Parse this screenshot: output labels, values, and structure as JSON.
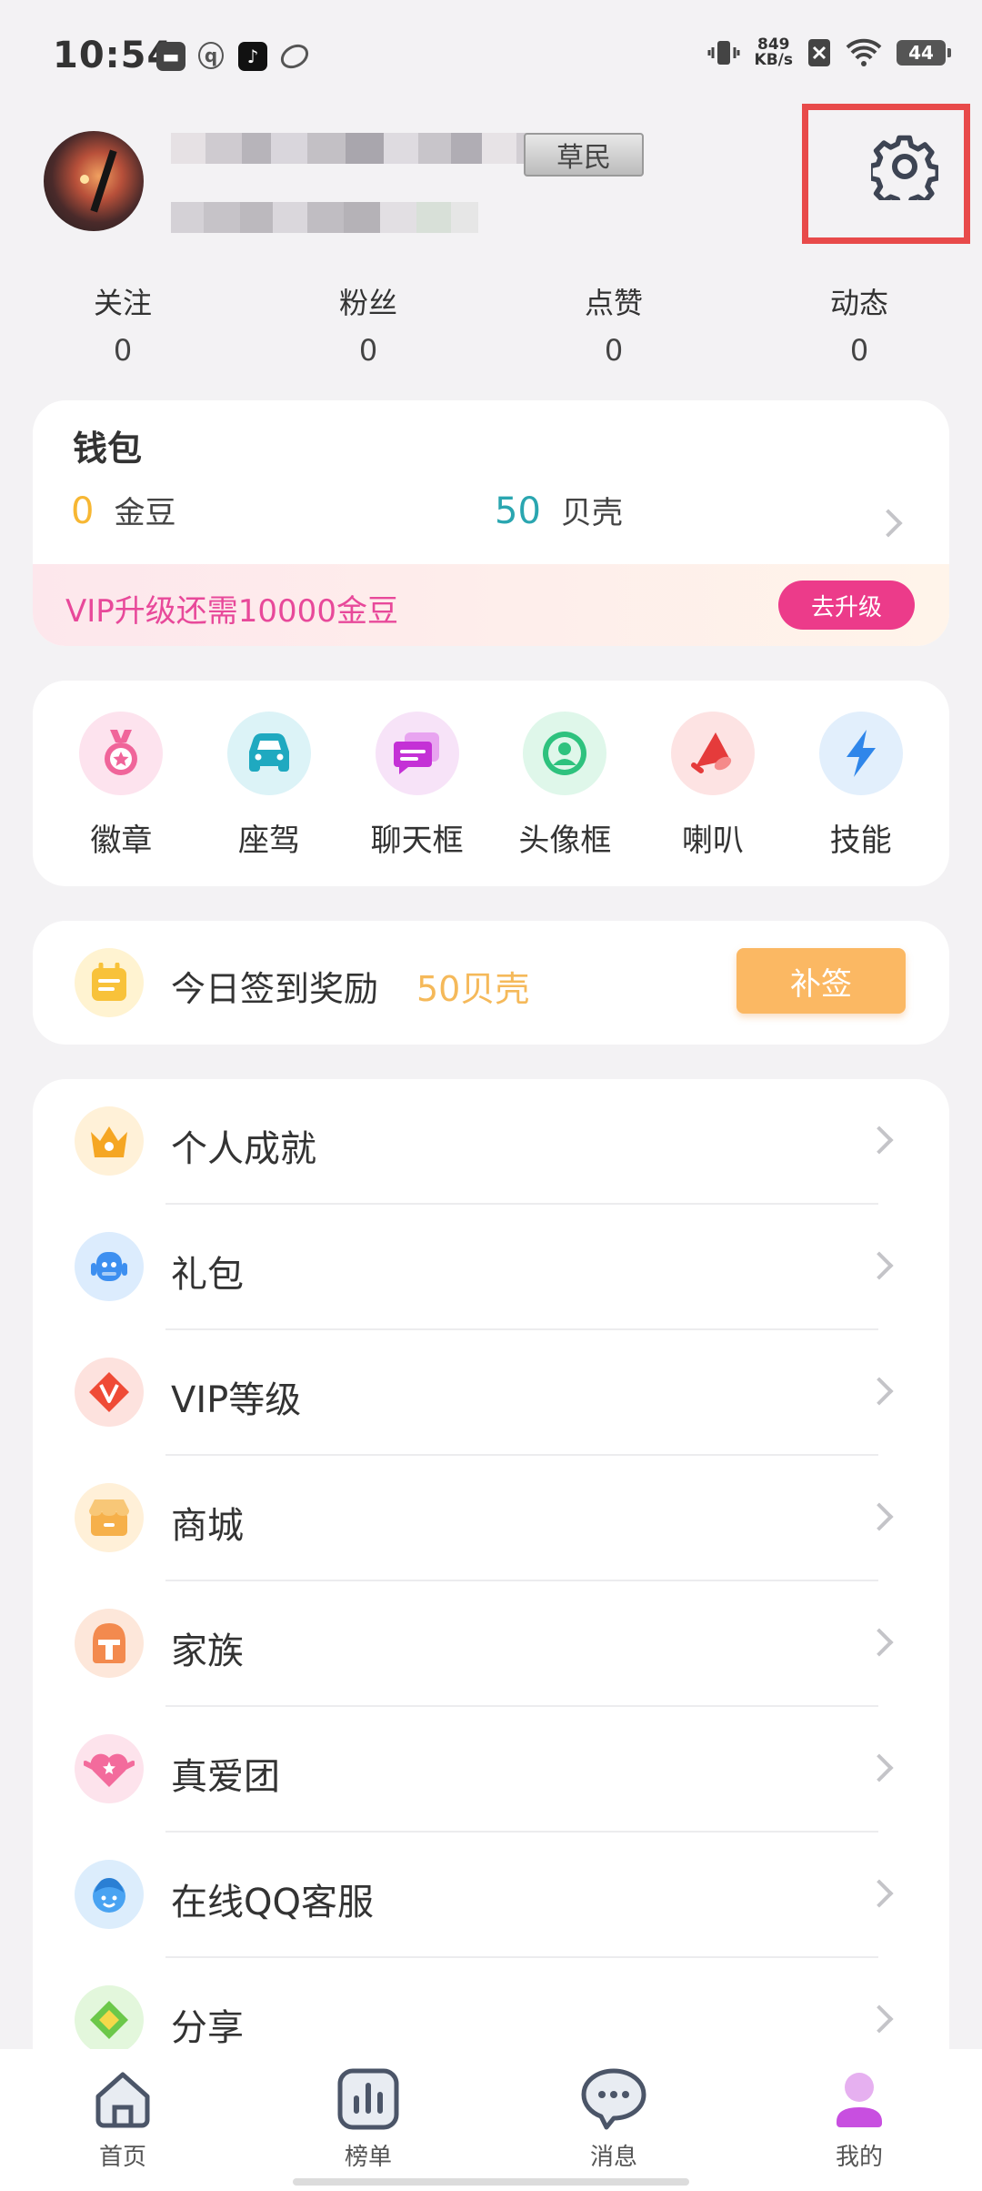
{
  "status_bar": {
    "time": "10:54",
    "speed_value": "849",
    "speed_unit": "KB/s",
    "battery": "44",
    "notification_icons": [
      "message-icon",
      "qq-icon",
      "tiktok-icon",
      "app-icon"
    ],
    "system_icons": [
      "vibrate-icon",
      "wifi-icon",
      "battery-icon"
    ]
  },
  "profile": {
    "rank_badge": "草民"
  },
  "stats": [
    {
      "label": "关注",
      "value": "0"
    },
    {
      "label": "粉丝",
      "value": "0"
    },
    {
      "label": "点赞",
      "value": "0"
    },
    {
      "label": "动态",
      "value": "0"
    }
  ],
  "wallet": {
    "title": "钱包",
    "gold_value": "0",
    "gold_unit": "金豆",
    "shell_value": "50",
    "shell_unit": "贝壳",
    "vip_text": "VIP升级还需10000金豆",
    "vip_button": "去升级"
  },
  "shortcuts": [
    {
      "label": "徽章",
      "icon": "badge-icon",
      "bg": "#fde3ee"
    },
    {
      "label": "座驾",
      "icon": "car-icon",
      "bg": "#dcf3f7"
    },
    {
      "label": "聊天框",
      "icon": "chat-frame-icon",
      "bg": "#f7e3f8"
    },
    {
      "label": "头像框",
      "icon": "avatar-frame-icon",
      "bg": "#dff7ea"
    },
    {
      "label": "喇叭",
      "icon": "horn-icon",
      "bg": "#fde3e3"
    },
    {
      "label": "技能",
      "icon": "lightning-icon",
      "bg": "#e2effc"
    }
  ],
  "checkin": {
    "text": "今日签到奖励",
    "reward": "50贝壳",
    "button": "补签"
  },
  "menu": [
    {
      "label": "个人成就",
      "icon": "crown-icon",
      "bg": "#fff1d8"
    },
    {
      "label": "礼包",
      "icon": "robot-icon",
      "bg": "#dcecfd"
    },
    {
      "label": "VIP等级",
      "icon": "vip-diamond-icon",
      "bg": "#fde2de"
    },
    {
      "label": "商城",
      "icon": "shop-icon",
      "bg": "#fff0d8"
    },
    {
      "label": "家族",
      "icon": "helmet-icon",
      "bg": "#fde7da"
    },
    {
      "label": "真爱团",
      "icon": "heart-icon",
      "bg": "#fde3ec"
    },
    {
      "label": "在线QQ客服",
      "icon": "service-icon",
      "bg": "#dcedfc"
    },
    {
      "label": "分享",
      "icon": "share-icon",
      "bg": "#e3f7dc"
    }
  ],
  "bottom_nav": [
    {
      "label": "首页",
      "icon": "home-icon"
    },
    {
      "label": "榜单",
      "icon": "chart-icon"
    },
    {
      "label": "消息",
      "icon": "message-bubble-icon"
    },
    {
      "label": "我的",
      "icon": "profile-icon"
    }
  ],
  "colors": {
    "gold": "#f7b733",
    "shell": "#2aa6b0",
    "vip_pink": "#ec3b8a",
    "checkin_orange": "#fbb863",
    "highlight_box": "#e84a4a",
    "nav_active": "#c84fe0"
  }
}
